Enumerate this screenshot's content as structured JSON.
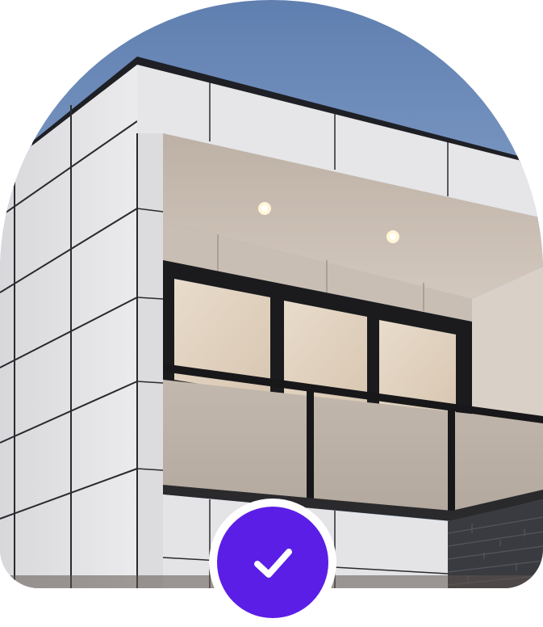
{
  "image": {
    "subject": "modern-house-balcony",
    "alt": ""
  },
  "badge": {
    "icon": "check-icon",
    "color": "#5b1ee6",
    "ring_color": "#ffffff"
  },
  "colors": {
    "sky": "#8fa9cf",
    "cladding": "#e4e4e6",
    "soffit": "#cbbfb4",
    "glass_panel": "#bdb2a7",
    "frame": "#1b1b1d",
    "brick": "#3a3b40"
  }
}
